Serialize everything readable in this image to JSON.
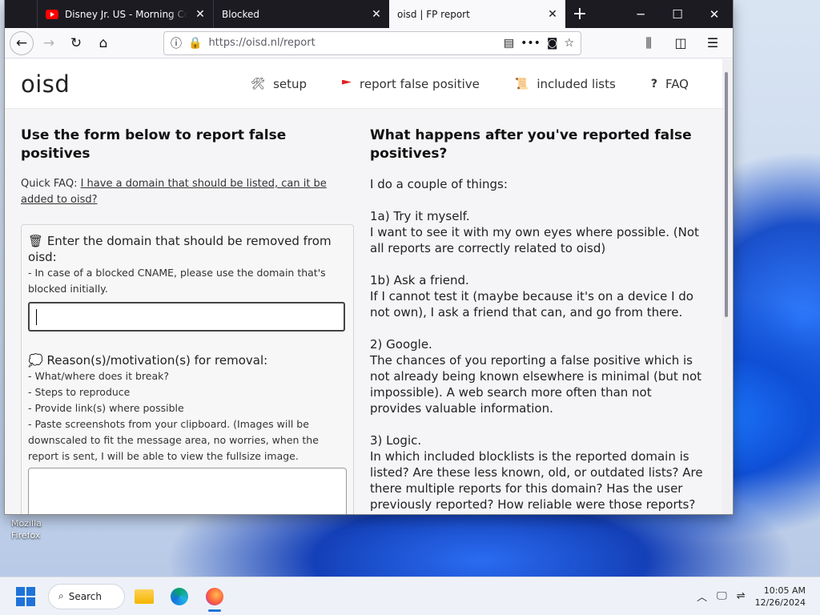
{
  "browser": {
    "tabs": [
      {
        "title": "Disney Jr. US - Morning Conti",
        "active": false,
        "icon": "youtube-icon"
      },
      {
        "title": "Blocked",
        "active": false,
        "icon": ""
      },
      {
        "title": "oisd | FP report",
        "active": true,
        "icon": ""
      }
    ],
    "url": "https://oisd.nl/report"
  },
  "site": {
    "logo": "oisd",
    "nav": [
      {
        "label": "setup",
        "icon": "tools-icon"
      },
      {
        "label": "report false positive",
        "icon": "flag-icon"
      },
      {
        "label": "included lists",
        "icon": "scroll-icon"
      },
      {
        "label": "FAQ",
        "icon": "question-icon"
      }
    ]
  },
  "form": {
    "heading": "Use the form below to report false positives",
    "quickfaq_prefix": "Quick FAQ:",
    "quickfaq_link": "I have a domain that should be listed, can it be added to oisd?",
    "domain_label": "Enter the domain that should be removed from oisd:",
    "domain_hint": "- In case of a blocked CNAME, please use the domain that's blocked initially.",
    "domain_value": "",
    "reason_label": "Reason(s)/motivation(s) for removal:",
    "reason_hints": [
      "- What/where does it break?",
      "- Steps to reproduce",
      "- Provide link(s) where possible",
      "- Paste screenshots from your clipboard. (Images will be downscaled to fit the message area, no worries, when the report is sent, I will be able to view the fullsize image."
    ]
  },
  "info": {
    "heading": "What happens after you've reported false positives?",
    "intro": "I do a couple of things:",
    "steps": [
      {
        "title": "1a) Try it myself.",
        "body": "I want to see it with my own eyes where possible. (Not all reports are correctly related to oisd)"
      },
      {
        "title": "1b) Ask a friend.",
        "body": "If I cannot test it (maybe because it's on a device I do not own), I ask a friend that can, and go from there."
      },
      {
        "title": "2) Google.",
        "body": "The chances of you reporting a false positive which is not already being known elsewhere is minimal (but not impossible). A web search more often than not provides valuable information."
      },
      {
        "title": "3) Logic.",
        "body": "In which included blocklists is the reported domain is listed? Are these less known, old, or outdated lists? Are there multiple reports for this domain? Has the user previously reported? How reliable were those reports?"
      }
    ]
  },
  "desktop": {
    "icon_label_line1": "Mozilla",
    "icon_label_line2": "Firefox"
  },
  "taskbar": {
    "search_label": "Search",
    "time": "10:05 AM",
    "date": "12/26/2024"
  }
}
